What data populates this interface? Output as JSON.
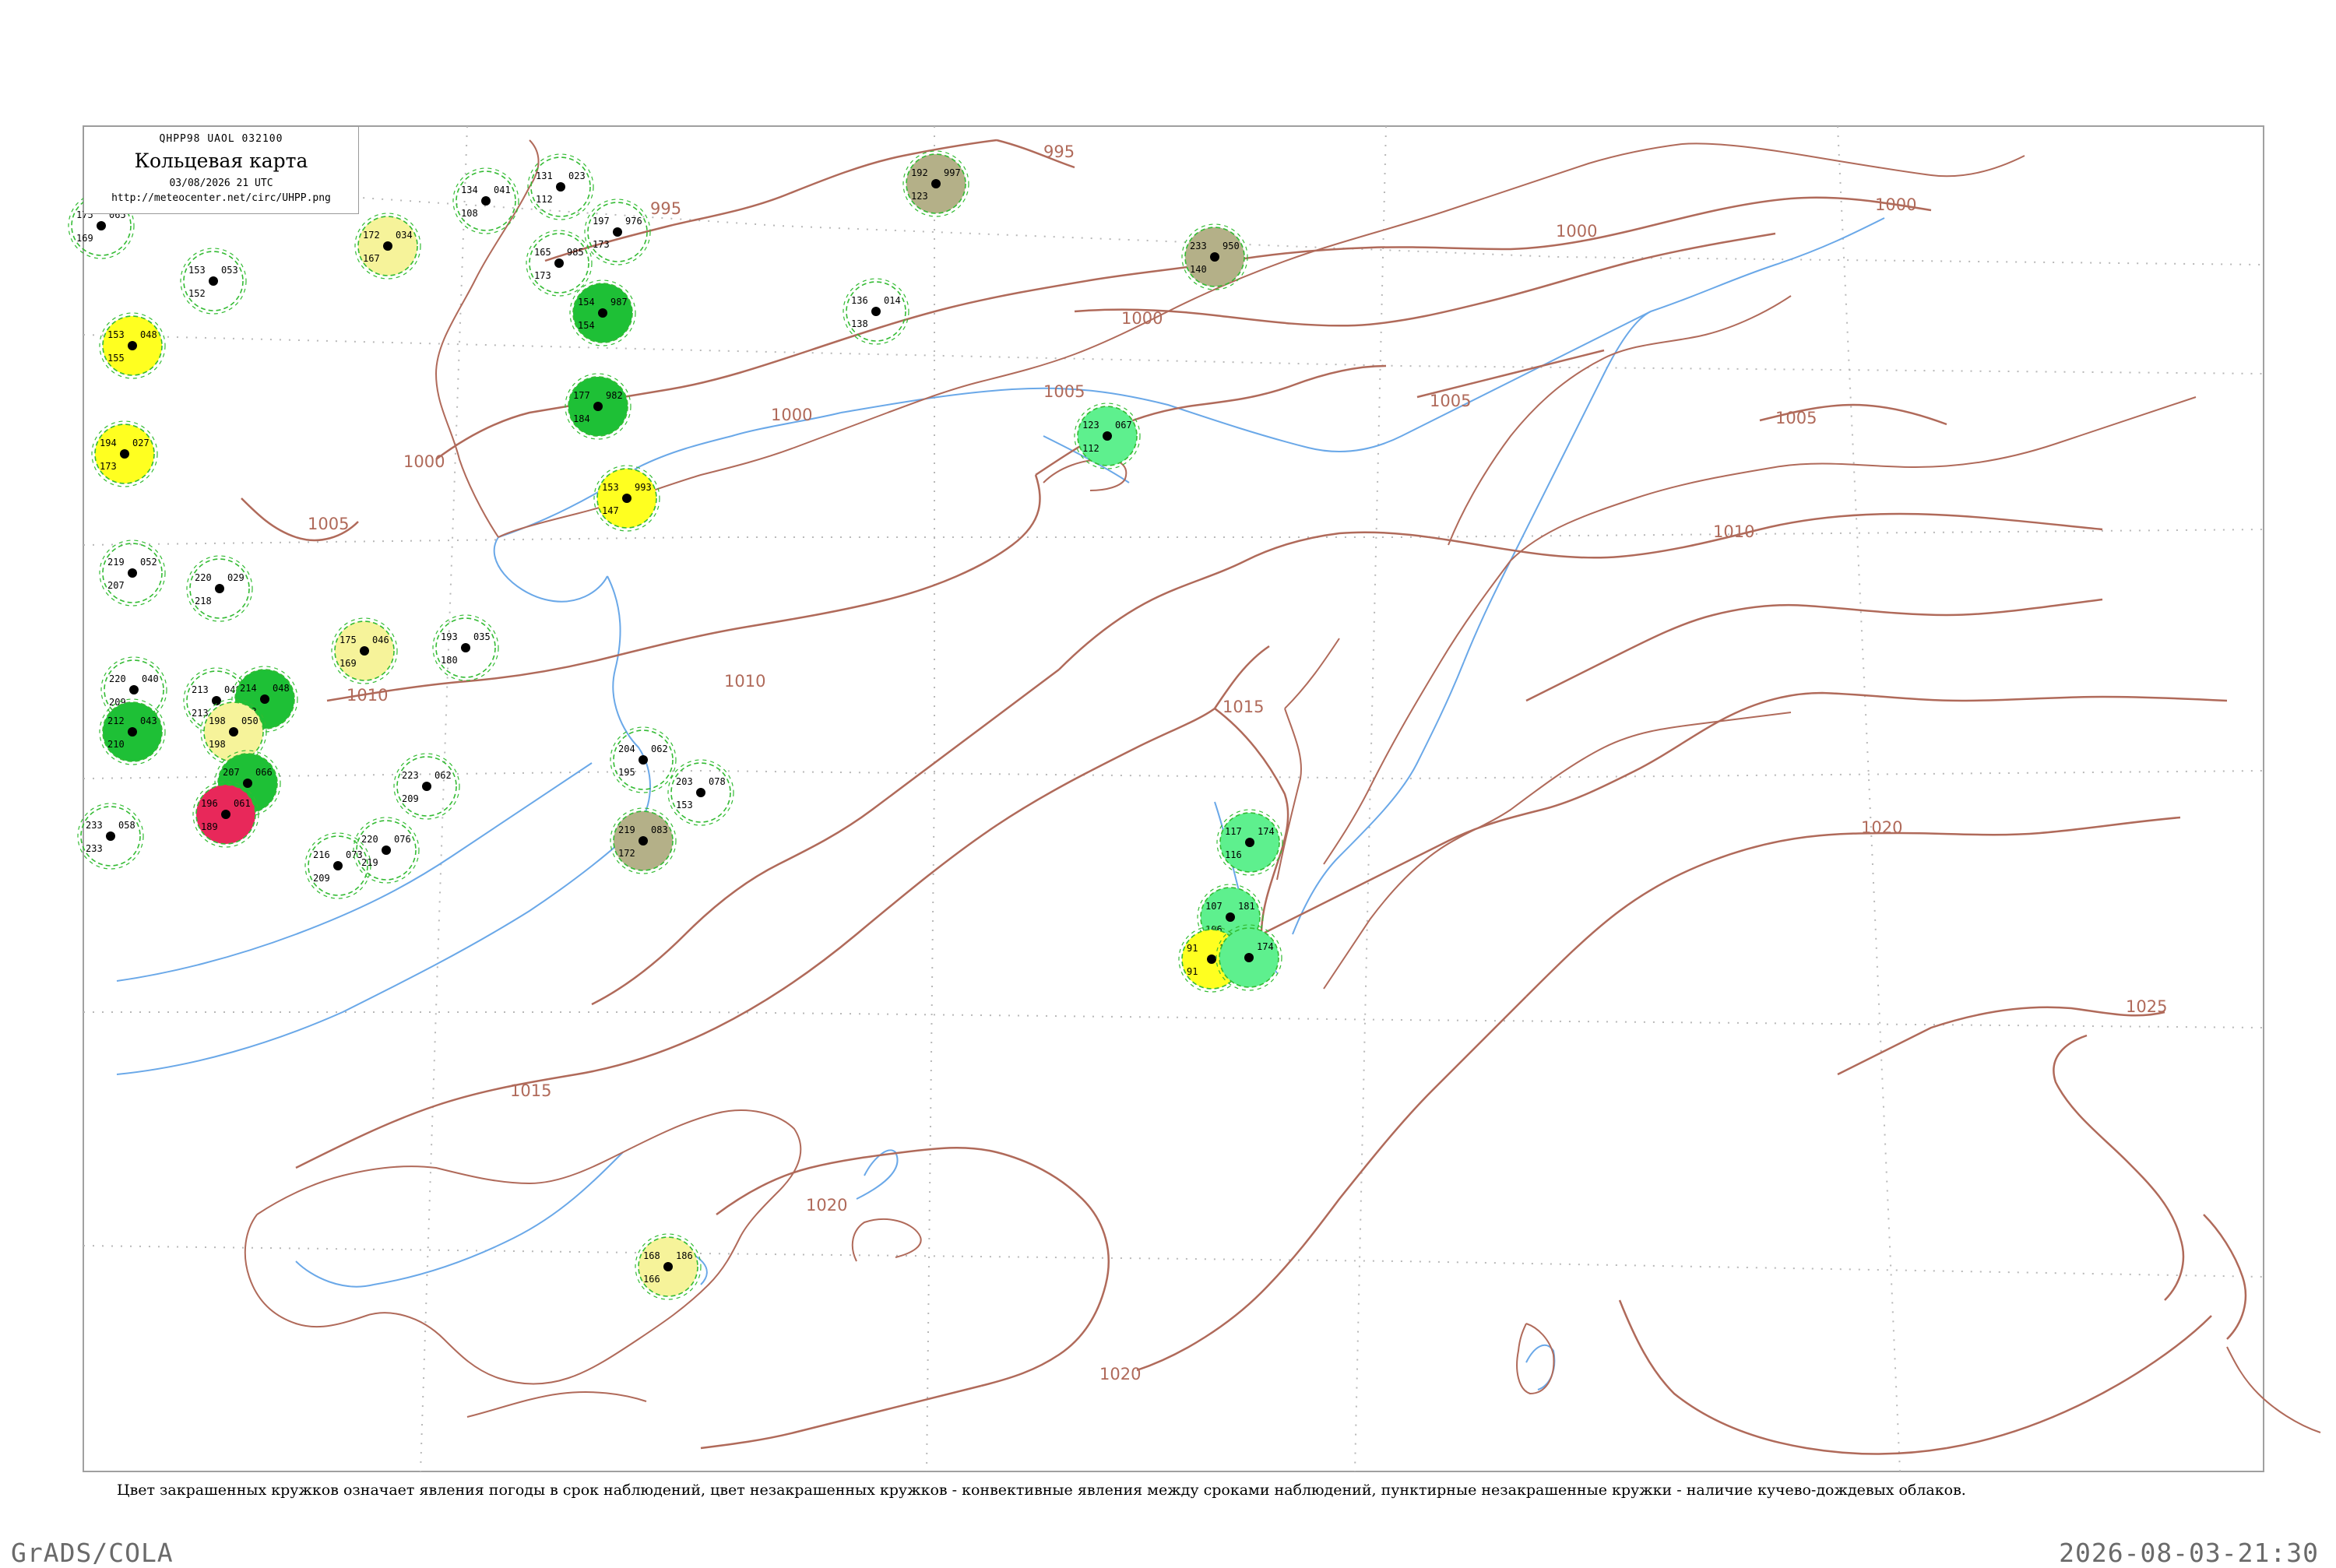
{
  "header": {
    "code": "QHPP98  UAOL  032100",
    "title": "Кольцевая карта",
    "datetime": "03/08/2026 21 UTC",
    "url": "http://meteocenter.net/circ/UHPP.png"
  },
  "caption": "Цвет закрашенных кружков означает явления погоды в срок наблюдений, цвет незакрашенных кружков - конвективные явления между сроками наблюдений, пунктирные незакрашенные кружки - наличие кучево-дождевых облаков.",
  "footer": {
    "left": "GrADS/COLA",
    "right": "2026-08-03-21:30"
  },
  "colors": {
    "isobar": "#b06a5a",
    "coast": "#6aa8e8",
    "frame": "#a0a0a0",
    "station_green": "#1ec036",
    "station_yellow": "#ffff20",
    "station_pale_yellow": "#f6f39a",
    "station_red": "#e8285a",
    "station_khaki": "#b4b088",
    "station_mint": "#5ef08e",
    "ring_dashed": "#33bb33"
  },
  "isobars": [
    {
      "label": "995"
    },
    {
      "label": "995"
    },
    {
      "label": "1000"
    },
    {
      "label": "1000"
    },
    {
      "label": "1000"
    },
    {
      "label": "1000"
    },
    {
      "label": "1000"
    },
    {
      "label": "1005"
    },
    {
      "label": "1005"
    },
    {
      "label": "1005"
    },
    {
      "label": "1005"
    },
    {
      "label": "1010"
    },
    {
      "label": "1010"
    },
    {
      "label": "1010"
    },
    {
      "label": "1015"
    },
    {
      "label": "1015"
    },
    {
      "label": "1020"
    },
    {
      "label": "1020"
    },
    {
      "label": "1020"
    },
    {
      "label": "1025"
    }
  ],
  "stations": [
    {
      "fill": "ring",
      "t": "175",
      "p": "065",
      "d": "169"
    },
    {
      "fill": "pale_yellow",
      "t": "172",
      "p": "034",
      "d": "167"
    },
    {
      "fill": "ring",
      "t": "153",
      "p": "053",
      "d": "152"
    },
    {
      "fill": "yellow",
      "t": "153",
      "p": "048",
      "d": "155"
    },
    {
      "fill": "ring",
      "t": "134",
      "p": "041",
      "d": "108"
    },
    {
      "fill": "ring",
      "t": "131",
      "p": "023",
      "d": "112"
    },
    {
      "fill": "ring",
      "t": "165",
      "p": "985",
      "d": "173"
    },
    {
      "fill": "ring",
      "t": "197",
      "p": "976",
      "d": "173"
    },
    {
      "fill": "green",
      "t": "154",
      "p": "987",
      "d": "154"
    },
    {
      "fill": "green",
      "t": "177",
      "p": "982",
      "d": "184"
    },
    {
      "fill": "yellow",
      "t": "194",
      "p": "027",
      "d": "173"
    },
    {
      "fill": "yellow",
      "t": "153",
      "p": "993",
      "d": "147"
    },
    {
      "fill": "khaki",
      "t": "192",
      "p": "997",
      "d": "123"
    },
    {
      "fill": "khaki",
      "t": "233",
      "p": "950",
      "d": "140"
    },
    {
      "fill": "ring",
      "t": "136",
      "p": "014",
      "d": "138"
    },
    {
      "fill": "mint",
      "t": "123",
      "p": "067",
      "d": "112"
    },
    {
      "fill": "ring",
      "t": "219",
      "p": "052",
      "d": "207"
    },
    {
      "fill": "ring",
      "t": "220",
      "p": "029",
      "d": "218"
    },
    {
      "fill": "pale_yellow",
      "t": "175",
      "p": "046",
      "d": "169"
    },
    {
      "fill": "ring",
      "t": "193",
      "p": "035",
      "d": "180"
    },
    {
      "fill": "ring",
      "t": "220",
      "p": "040",
      "d": "209"
    },
    {
      "fill": "ring",
      "t": "213",
      "p": "048",
      "d": "213"
    },
    {
      "fill": "green",
      "t": "214",
      "p": "048",
      "d": "213"
    },
    {
      "fill": "green",
      "t": "212",
      "p": "043",
      "d": "210"
    },
    {
      "fill": "pale_yellow",
      "t": "198",
      "p": "050",
      "d": "198"
    },
    {
      "fill": "green",
      "t": "207",
      "p": "066",
      "d": "196"
    },
    {
      "fill": "red",
      "t": "196",
      "p": "061",
      "d": "189"
    },
    {
      "fill": "ring",
      "t": "233",
      "p": "058",
      "d": "233"
    },
    {
      "fill": "ring",
      "t": "216",
      "p": "073",
      "d": "209"
    },
    {
      "fill": "ring",
      "t": "220",
      "p": "076",
      "d": "219"
    },
    {
      "fill": "ring",
      "t": "223",
      "p": "062",
      "d": "209"
    },
    {
      "fill": "ring",
      "t": "204",
      "p": "062",
      "d": "195"
    },
    {
      "fill": "ring",
      "t": "203",
      "p": "078",
      "d": "153"
    },
    {
      "fill": "khaki",
      "t": "219",
      "p": "083",
      "d": "172"
    },
    {
      "fill": "mint",
      "t": "117",
      "p": "174",
      "d": "116"
    },
    {
      "fill": "mint",
      "t": "107",
      "p": "181",
      "d": "106"
    },
    {
      "fill": "yellow",
      "t": "91",
      "p": "183",
      "d": "91"
    },
    {
      "fill": "mint",
      "t": "",
      "p": "174",
      "d": ""
    },
    {
      "fill": "pale_yellow",
      "t": "168",
      "p": "186",
      "d": "166"
    }
  ]
}
